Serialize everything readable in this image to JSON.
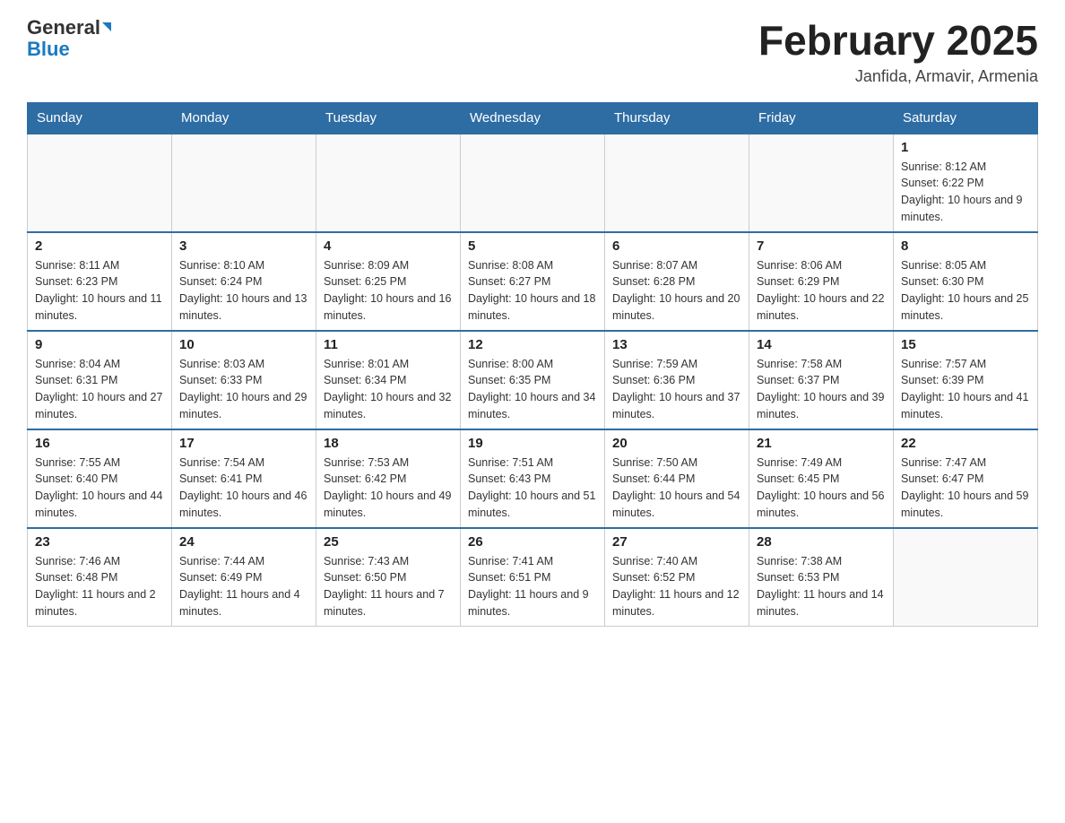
{
  "header": {
    "logo_top": "General",
    "logo_bottom": "Blue",
    "title": "February 2025",
    "subtitle": "Janfida, Armavir, Armenia"
  },
  "weekdays": [
    "Sunday",
    "Monday",
    "Tuesday",
    "Wednesday",
    "Thursday",
    "Friday",
    "Saturday"
  ],
  "weeks": [
    [
      {
        "day": "",
        "info": ""
      },
      {
        "day": "",
        "info": ""
      },
      {
        "day": "",
        "info": ""
      },
      {
        "day": "",
        "info": ""
      },
      {
        "day": "",
        "info": ""
      },
      {
        "day": "",
        "info": ""
      },
      {
        "day": "1",
        "info": "Sunrise: 8:12 AM\nSunset: 6:22 PM\nDaylight: 10 hours and 9 minutes."
      }
    ],
    [
      {
        "day": "2",
        "info": "Sunrise: 8:11 AM\nSunset: 6:23 PM\nDaylight: 10 hours and 11 minutes."
      },
      {
        "day": "3",
        "info": "Sunrise: 8:10 AM\nSunset: 6:24 PM\nDaylight: 10 hours and 13 minutes."
      },
      {
        "day": "4",
        "info": "Sunrise: 8:09 AM\nSunset: 6:25 PM\nDaylight: 10 hours and 16 minutes."
      },
      {
        "day": "5",
        "info": "Sunrise: 8:08 AM\nSunset: 6:27 PM\nDaylight: 10 hours and 18 minutes."
      },
      {
        "day": "6",
        "info": "Sunrise: 8:07 AM\nSunset: 6:28 PM\nDaylight: 10 hours and 20 minutes."
      },
      {
        "day": "7",
        "info": "Sunrise: 8:06 AM\nSunset: 6:29 PM\nDaylight: 10 hours and 22 minutes."
      },
      {
        "day": "8",
        "info": "Sunrise: 8:05 AM\nSunset: 6:30 PM\nDaylight: 10 hours and 25 minutes."
      }
    ],
    [
      {
        "day": "9",
        "info": "Sunrise: 8:04 AM\nSunset: 6:31 PM\nDaylight: 10 hours and 27 minutes."
      },
      {
        "day": "10",
        "info": "Sunrise: 8:03 AM\nSunset: 6:33 PM\nDaylight: 10 hours and 29 minutes."
      },
      {
        "day": "11",
        "info": "Sunrise: 8:01 AM\nSunset: 6:34 PM\nDaylight: 10 hours and 32 minutes."
      },
      {
        "day": "12",
        "info": "Sunrise: 8:00 AM\nSunset: 6:35 PM\nDaylight: 10 hours and 34 minutes."
      },
      {
        "day": "13",
        "info": "Sunrise: 7:59 AM\nSunset: 6:36 PM\nDaylight: 10 hours and 37 minutes."
      },
      {
        "day": "14",
        "info": "Sunrise: 7:58 AM\nSunset: 6:37 PM\nDaylight: 10 hours and 39 minutes."
      },
      {
        "day": "15",
        "info": "Sunrise: 7:57 AM\nSunset: 6:39 PM\nDaylight: 10 hours and 41 minutes."
      }
    ],
    [
      {
        "day": "16",
        "info": "Sunrise: 7:55 AM\nSunset: 6:40 PM\nDaylight: 10 hours and 44 minutes."
      },
      {
        "day": "17",
        "info": "Sunrise: 7:54 AM\nSunset: 6:41 PM\nDaylight: 10 hours and 46 minutes."
      },
      {
        "day": "18",
        "info": "Sunrise: 7:53 AM\nSunset: 6:42 PM\nDaylight: 10 hours and 49 minutes."
      },
      {
        "day": "19",
        "info": "Sunrise: 7:51 AM\nSunset: 6:43 PM\nDaylight: 10 hours and 51 minutes."
      },
      {
        "day": "20",
        "info": "Sunrise: 7:50 AM\nSunset: 6:44 PM\nDaylight: 10 hours and 54 minutes."
      },
      {
        "day": "21",
        "info": "Sunrise: 7:49 AM\nSunset: 6:45 PM\nDaylight: 10 hours and 56 minutes."
      },
      {
        "day": "22",
        "info": "Sunrise: 7:47 AM\nSunset: 6:47 PM\nDaylight: 10 hours and 59 minutes."
      }
    ],
    [
      {
        "day": "23",
        "info": "Sunrise: 7:46 AM\nSunset: 6:48 PM\nDaylight: 11 hours and 2 minutes."
      },
      {
        "day": "24",
        "info": "Sunrise: 7:44 AM\nSunset: 6:49 PM\nDaylight: 11 hours and 4 minutes."
      },
      {
        "day": "25",
        "info": "Sunrise: 7:43 AM\nSunset: 6:50 PM\nDaylight: 11 hours and 7 minutes."
      },
      {
        "day": "26",
        "info": "Sunrise: 7:41 AM\nSunset: 6:51 PM\nDaylight: 11 hours and 9 minutes."
      },
      {
        "day": "27",
        "info": "Sunrise: 7:40 AM\nSunset: 6:52 PM\nDaylight: 11 hours and 12 minutes."
      },
      {
        "day": "28",
        "info": "Sunrise: 7:38 AM\nSunset: 6:53 PM\nDaylight: 11 hours and 14 minutes."
      },
      {
        "day": "",
        "info": ""
      }
    ]
  ]
}
